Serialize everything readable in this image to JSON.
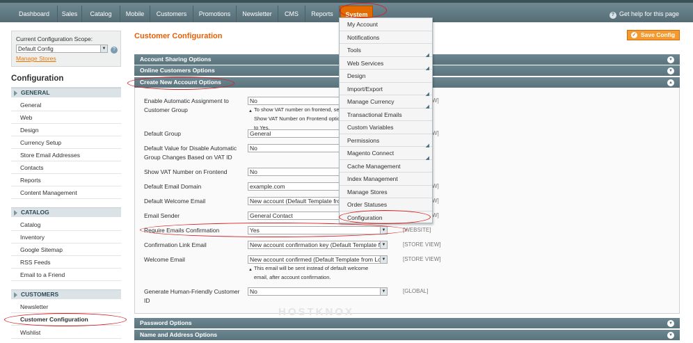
{
  "topnav": {
    "items": [
      "Dashboard",
      "Sales",
      "Catalog",
      "Mobile",
      "Customers",
      "Promotions",
      "Newsletter",
      "CMS",
      "Reports",
      "System"
    ],
    "help": "Get help for this page"
  },
  "scope": {
    "label": "Current Configuration Scope:",
    "value": "Default Config",
    "manage": "Manage Stores"
  },
  "sidebar": {
    "title": "Configuration",
    "sections": [
      {
        "heading": "GENERAL",
        "items": [
          "General",
          "Web",
          "Design",
          "Currency Setup",
          "Store Email Addresses",
          "Contacts",
          "Reports",
          "Content Management"
        ]
      },
      {
        "heading": "CATALOG",
        "items": [
          "Catalog",
          "Inventory",
          "Google Sitemap",
          "RSS Feeds",
          "Email to a Friend"
        ]
      },
      {
        "heading": "CUSTOMERS",
        "items": [
          "Newsletter",
          "Customer Configuration",
          "Wishlist"
        ]
      }
    ]
  },
  "main": {
    "title": "Customer Configuration",
    "save": "Save Config",
    "bands": {
      "sharing": "Account Sharing Options",
      "online": "Online Customers Options",
      "create": "Create New Account Options",
      "password": "Password Options",
      "name": "Name and Address Options"
    },
    "fields": [
      {
        "label": "Enable Automatic Assignment to Customer Group",
        "value": "No",
        "scope": "[WEBSITE]",
        "note": "To show VAT number on frontend, set Show VAT Number on Frontend option to Yes."
      },
      {
        "label": "Default Group",
        "value": "General",
        "scope": "[WEBSITE]"
      },
      {
        "label": "Default Value for Disable Automatic Group Changes Based on VAT ID",
        "value": "No",
        "scope": "[WEBSITE]"
      },
      {
        "label": "Show VAT Number on Frontend",
        "value": "No",
        "scope": "[WEBSITE]"
      },
      {
        "label": "Default Email Domain",
        "value": "example.com",
        "scope": "[STORE VIEW]"
      },
      {
        "label": "Default Welcome Email",
        "value": "New account (Default Template fro",
        "scope": "[STORE VIEW]"
      },
      {
        "label": "Email Sender",
        "value": "General Contact",
        "scope": "[STORE VIEW]"
      },
      {
        "label": "Require Emails Confirmation",
        "value": "Yes",
        "scope": "[WEBSITE]"
      },
      {
        "label": "Confirmation Link Email",
        "value": "New account confirmation key (Default Template fr",
        "scope": "[STORE VIEW]"
      },
      {
        "label": "Welcome Email",
        "value": "New account confirmed (Default Template from Lo",
        "scope": "[STORE VIEW]",
        "note": "This email will be sent instead of default welcome email, after account confirmation."
      },
      {
        "label": "Generate Human-Friendly Customer ID",
        "value": "No",
        "scope": "[GLOBAL]"
      }
    ]
  },
  "system_menu": {
    "items": [
      {
        "label": "My Account",
        "sub": false
      },
      {
        "label": "Notifications",
        "sub": false
      },
      {
        "label": "Tools",
        "sub": true
      },
      {
        "label": "Web Services",
        "sub": true
      },
      {
        "label": "Design",
        "sub": false
      },
      {
        "label": "Import/Export",
        "sub": true
      },
      {
        "label": "Manage Currency",
        "sub": true
      },
      {
        "label": "Transactional Emails",
        "sub": false
      },
      {
        "label": "Custom Variables",
        "sub": false
      },
      {
        "label": "Permissions",
        "sub": true
      },
      {
        "label": "Magento Connect",
        "sub": true
      },
      {
        "label": "Cache Management",
        "sub": false
      },
      {
        "label": "Index Management",
        "sub": false
      },
      {
        "label": "Manage Stores",
        "sub": false
      },
      {
        "label": "Order Statuses",
        "sub": false
      },
      {
        "label": "Configuration",
        "sub": false
      }
    ]
  },
  "watermark": "HOSTKNOX",
  "colors": {
    "accent": "#eb5e00",
    "nav": "#5f7a84",
    "highlight": "#d42020"
  }
}
